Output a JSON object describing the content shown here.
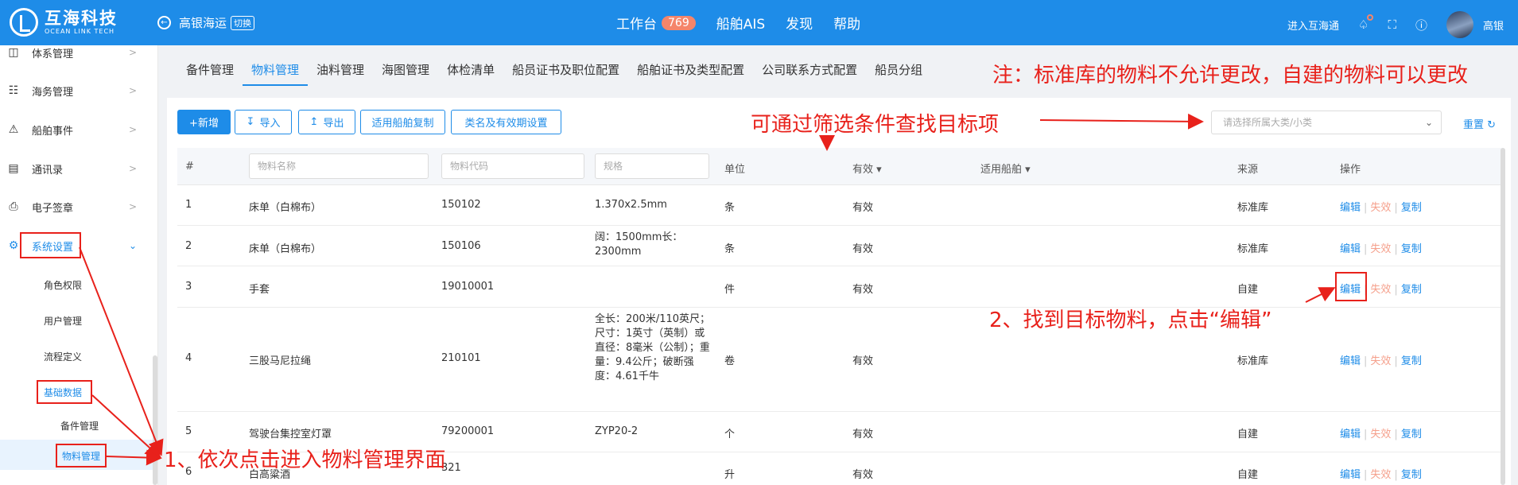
{
  "brand": {
    "name_cn": "互海科技",
    "name_en": "OCEAN LINK TECH"
  },
  "header": {
    "ship": "高银海运",
    "switch_label": "切换",
    "nav": [
      {
        "label": "工作台",
        "badge": "769"
      },
      {
        "label": "船舶AIS"
      },
      {
        "label": "发现"
      },
      {
        "label": "帮助"
      }
    ],
    "enter_link": "进入互海通",
    "user_name": "高银"
  },
  "sidebar": {
    "items": [
      {
        "label": "体系管理",
        "icon": "document-icon"
      },
      {
        "label": "海务管理",
        "icon": "signpost-icon"
      },
      {
        "label": "船舶事件",
        "icon": "warning-icon"
      },
      {
        "label": "通讯录",
        "icon": "contacts-icon"
      },
      {
        "label": "电子签章",
        "icon": "stamp-icon"
      },
      {
        "label": "系统设置",
        "icon": "gear-icon"
      }
    ],
    "sub_items": [
      "角色权限",
      "用户管理",
      "流程定义",
      "基础数据"
    ],
    "sub_sub_items": [
      "备件管理",
      "物料管理"
    ]
  },
  "tabs": [
    "备件管理",
    "物料管理",
    "油料管理",
    "海图管理",
    "体检清单",
    "船员证书及职位配置",
    "船舶证书及类型配置",
    "公司联系方式配置",
    "船员分组"
  ],
  "toolbar": {
    "add": "+新增",
    "import": "导入",
    "export": "导出",
    "apply_copy": "适用船舶复制",
    "category_settings": "类名及有效期设置",
    "category_placeholder": "请选择所属大类/小类",
    "reset": "重置"
  },
  "table": {
    "headers": {
      "index": "#",
      "unit": "单位",
      "valid": "有效",
      "ships": "适用船舶",
      "source": "来源",
      "ops": "操作"
    },
    "filters": {
      "name": "物料名称",
      "code": "物料代码",
      "spec": "规格"
    },
    "rows": [
      {
        "index": "1",
        "name": "床单（白棉布）",
        "code": "150102",
        "spec": "1.370x2.5mm",
        "unit": "条",
        "valid": "有效",
        "source": "标准库"
      },
      {
        "index": "2",
        "name": "床单（白棉布）",
        "code": "150106",
        "spec": "阔：1500mm长：2300mm",
        "unit": "条",
        "valid": "有效",
        "source": "标准库"
      },
      {
        "index": "3",
        "name": "手套",
        "code": "19010001",
        "spec": "",
        "unit": "件",
        "valid": "有效",
        "source": "自建"
      },
      {
        "index": "4",
        "name": "三股马尼拉绳",
        "code": "210101",
        "spec": "全长：200米/110英尺；尺寸：1英寸（英制）或直径：8毫米（公制）；重量：9.4公斤；破断强度：4.61千牛",
        "unit": "卷",
        "valid": "有效",
        "source": "标准库"
      },
      {
        "index": "5",
        "name": "驾驶台集控室灯罩",
        "code": "79200001",
        "spec": "ZYP20-2",
        "unit": "个",
        "valid": "有效",
        "source": "自建"
      },
      {
        "index": "6",
        "name": "白高粱酒",
        "code": "321",
        "spec": "",
        "unit": "升",
        "valid": "有效",
        "source": "自建"
      }
    ],
    "ops": {
      "edit": "编辑",
      "disable": "失效",
      "copy": "复制"
    }
  },
  "annotations": {
    "note": "注：标准库的物料不允许更改，自建的物料可以更改",
    "filter_hint": "可通过筛选条件查找目标项",
    "step2": "2、找到目标物料，点击“编辑”",
    "step1": "1、依次点击进入物料管理界面"
  },
  "colors": {
    "primary": "#1e8ce8",
    "annotation": "#e8211b",
    "disable": "#f5a08c"
  }
}
